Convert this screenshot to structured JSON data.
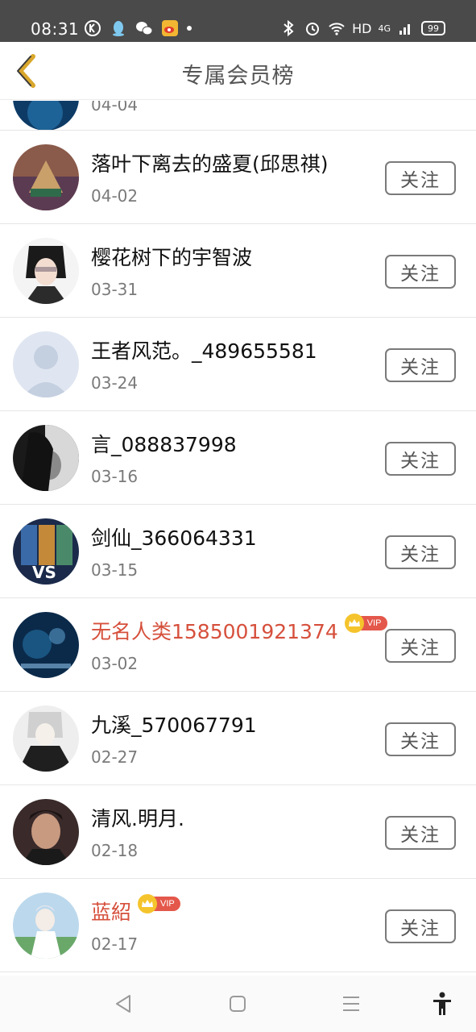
{
  "status_bar": {
    "time": "08:31",
    "network": "HD",
    "signal": "4G",
    "battery": "99",
    "icons": [
      "k-circle-icon",
      "qq-icon",
      "wechat-icon",
      "weibo-icon",
      "bluetooth-icon",
      "alarm-icon",
      "wifi-icon",
      "signal-icon",
      "battery-icon"
    ]
  },
  "header": {
    "title": "专属会员榜",
    "back_icon": "chevron-left-icon",
    "accent_color": "#d9a72c"
  },
  "partial_row": {
    "date": "04-04"
  },
  "rows": [
    {
      "name": "落叶下离去的盛夏(邱思祺)",
      "date": "04-02",
      "vip": false,
      "follow": "关注"
    },
    {
      "name": "樱花树下的宇智波",
      "date": "03-31",
      "vip": false,
      "follow": "关注"
    },
    {
      "name": "王者风范。_489655581",
      "date": "03-24",
      "vip": false,
      "follow": "关注"
    },
    {
      "name": "言_088837998",
      "date": "03-16",
      "vip": false,
      "follow": "关注"
    },
    {
      "name": "剑仙_366064331",
      "date": "03-15",
      "vip": false,
      "follow": "关注"
    },
    {
      "name": "无名人类1585001921374",
      "date": "03-02",
      "vip": true,
      "vip_label": "VIP",
      "follow": "关注"
    },
    {
      "name": "九溪_570067791",
      "date": "02-27",
      "vip": false,
      "follow": "关注"
    },
    {
      "name": "清风.明月.",
      "date": "02-18",
      "vip": false,
      "follow": "关注"
    },
    {
      "name": "蓝紹",
      "date": "02-17",
      "vip": true,
      "vip_label": "VIP",
      "follow": "关注"
    }
  ],
  "colors": {
    "vip_name": "#d6503c",
    "vip_badge": "#e4574b",
    "crown": "#f5c42c",
    "status_bar": "#4a4a4a"
  },
  "navbar": {
    "icons": [
      "back-triangle-icon",
      "home-square-icon",
      "menu-lines-icon",
      "accessibility-icon"
    ]
  }
}
